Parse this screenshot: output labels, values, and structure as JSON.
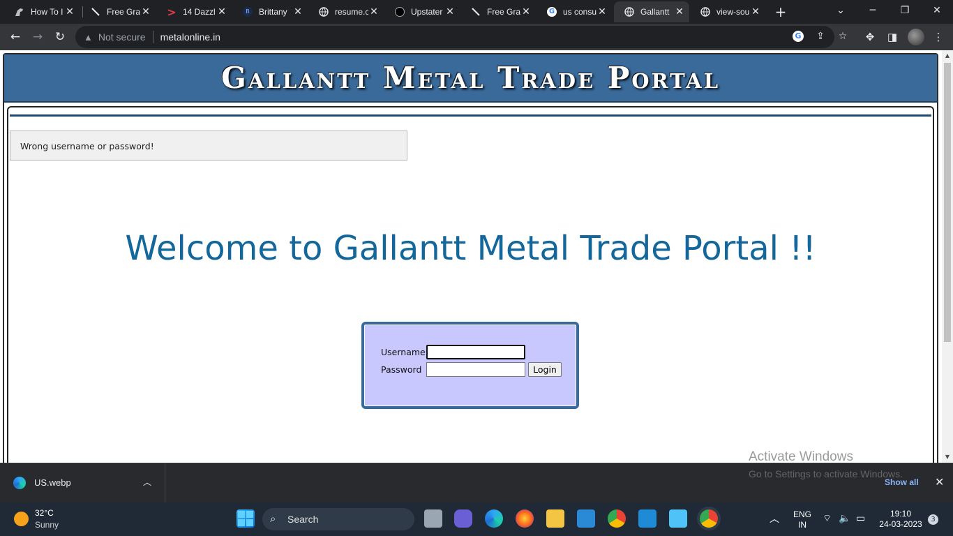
{
  "browser": {
    "tabs": [
      {
        "title": "How To I",
        "icon": "horse-icon"
      },
      {
        "title": "Free Gra",
        "icon": "feather-icon"
      },
      {
        "title": "14 Dazzl",
        "icon": "chevron-red-icon"
      },
      {
        "title": "Brittany",
        "icon": "letter-b-icon"
      },
      {
        "title": "resume.c",
        "icon": "globe-icon"
      },
      {
        "title": "Upstater",
        "icon": "upstate-icon"
      },
      {
        "title": "Free Gra",
        "icon": "feather-icon"
      },
      {
        "title": "us consu",
        "icon": "google-icon"
      },
      {
        "title": "Gallantt",
        "icon": "globe-icon",
        "active": true
      },
      {
        "title": "view-sou",
        "icon": "globe-icon"
      }
    ],
    "address": {
      "security_label": "Not secure",
      "url": "metalonline.in"
    }
  },
  "page": {
    "banner_title": "Gallantt Metal Trade Portal",
    "error_message": "Wrong username or password!",
    "welcome_heading": "Welcome to Gallantt Metal Trade Portal !!",
    "login": {
      "username_label": "Username",
      "password_label": "Password",
      "username_value": "",
      "password_value": "",
      "login_button": "Login"
    }
  },
  "watermark": {
    "line1": "Activate Windows",
    "line2": "Go to Settings to activate Windows."
  },
  "download_bar": {
    "file_name": "US.webp",
    "show_all": "Show all"
  },
  "taskbar": {
    "weather_temp": "32°C",
    "weather_condition": "Sunny",
    "search_label": "Search",
    "lang_line1": "ENG",
    "lang_line2": "IN",
    "time": "19:10",
    "date": "24-03-2023",
    "notification_count": "3"
  },
  "colors": {
    "banner_bg": "#3a6a9a",
    "welcome_text": "#14679a",
    "login_bg": "#c8c8ff",
    "chrome_dark": "#202124",
    "chrome_toolbar": "#35363a"
  }
}
